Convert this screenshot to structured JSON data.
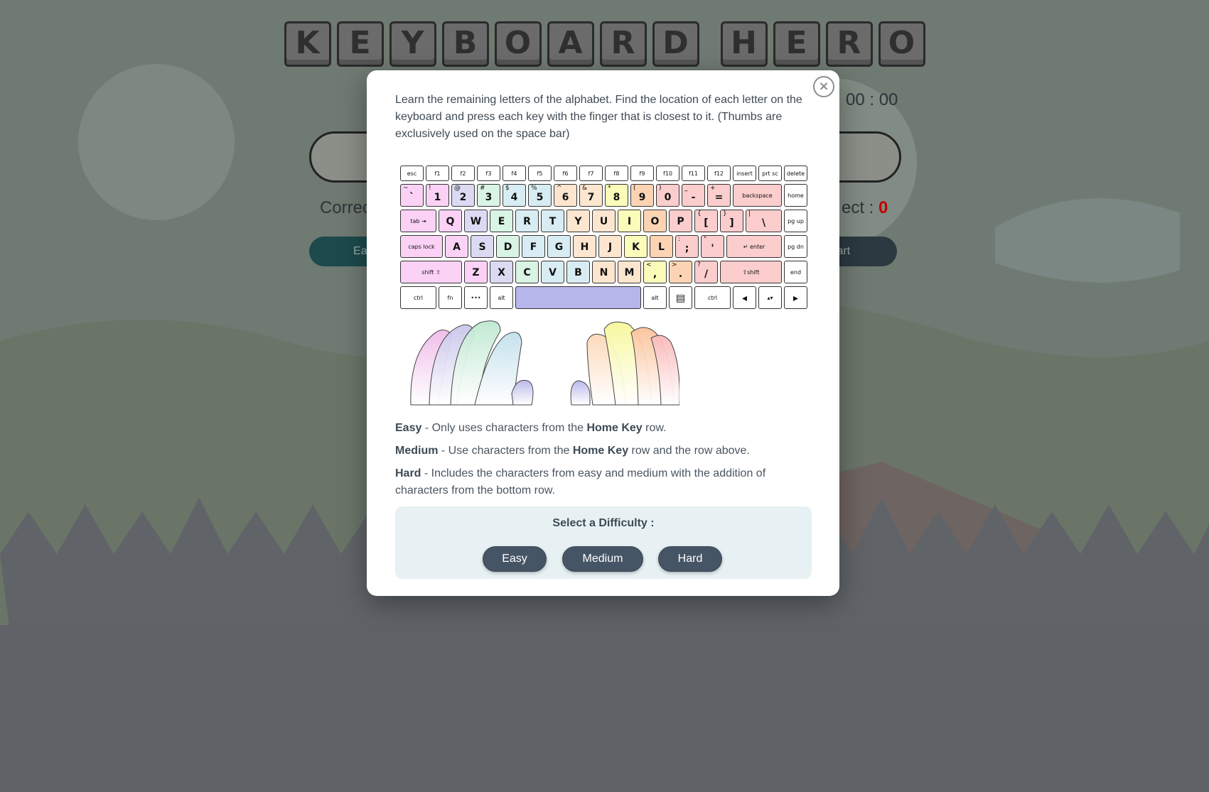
{
  "app": {
    "title_letters": [
      "K",
      "E",
      "Y",
      "B",
      "O",
      "A",
      "R",
      "D",
      " ",
      "H",
      "E",
      "R",
      "O"
    ],
    "timer": "00 : 00",
    "correct_label": "Correct :",
    "incorrect_label": "ect :",
    "incorrect_value": "0",
    "easy_partial": "Ea",
    "start_partial": "tart"
  },
  "colors": {
    "pinky_left": "#fbd2f6",
    "ring_left": "#dcdaf2",
    "middle_left": "#d9f3e4",
    "index_left": "#d8edf3",
    "index_right": "#fde6cf",
    "middle_right": "#fbfbba",
    "ring_right": "#fcd4b4",
    "pinky_right": "#fbcdcd",
    "thumb": "#b7b6ea",
    "button": "#465566",
    "incorrect": "#c40000"
  },
  "modal": {
    "close_symbol": "×",
    "intro": "Learn the remaining letters of the alphabet. Find the location of each letter on the keyboard and press each key with the finger that is closest to it. (Thumbs are exclusively used on the space bar)",
    "easy": {
      "term": "Easy",
      "pre": " - Only uses characters from the ",
      "bold": "Home Key",
      "post": " row."
    },
    "medium": {
      "term": "Medium",
      "pre": " - Use characters from the ",
      "bold": "Home Key",
      "post": " row and the row above."
    },
    "hard": {
      "term": "Hard",
      "text": " - Includes the characters from easy and medium with the addition of characters from the bottom row."
    },
    "select_label": "Select a Difficulty :",
    "buttons": {
      "easy": "Easy",
      "medium": "Medium",
      "hard": "Hard"
    }
  },
  "keyboard": {
    "rows": [
      [
        {
          "m": "esc",
          "f": "n"
        },
        {
          "m": "f1",
          "f": "n"
        },
        {
          "m": "f2",
          "f": "n"
        },
        {
          "m": "f3",
          "f": "n"
        },
        {
          "m": "f4",
          "f": "n"
        },
        {
          "m": "f5",
          "f": "n"
        },
        {
          "m": "f6",
          "f": "n"
        },
        {
          "m": "f7",
          "f": "n"
        },
        {
          "m": "f8",
          "f": "n"
        },
        {
          "m": "f9",
          "f": "n"
        },
        {
          "m": "f10",
          "f": "n"
        },
        {
          "m": "f11",
          "f": "n"
        },
        {
          "m": "f12",
          "f": "n"
        },
        {
          "m": "insert",
          "f": "n"
        },
        {
          "m": "prt sc",
          "f": "n"
        },
        {
          "m": "delete",
          "f": "n"
        }
      ],
      [
        {
          "m": "`",
          "s": "~",
          "f": "lp"
        },
        {
          "m": "1",
          "s": "!",
          "f": "lp"
        },
        {
          "m": "2",
          "s": "@",
          "f": "lr"
        },
        {
          "m": "3",
          "s": "#",
          "f": "lm"
        },
        {
          "m": "4",
          "s": "$",
          "f": "li"
        },
        {
          "m": "5",
          "s": "%",
          "f": "li"
        },
        {
          "m": "6",
          "s": "^",
          "f": "ri"
        },
        {
          "m": "7",
          "s": "&",
          "f": "ri"
        },
        {
          "m": "8",
          "s": "*",
          "f": "rm"
        },
        {
          "m": "9",
          "s": "(",
          "f": "rr"
        },
        {
          "m": "0",
          "s": ")",
          "f": "rp"
        },
        {
          "m": "-",
          "s": "_",
          "f": "rp"
        },
        {
          "m": "=",
          "s": "+",
          "f": "rp"
        },
        {
          "m": "backspace",
          "f": "rp"
        },
        {
          "m": "home",
          "f": "n"
        }
      ],
      [
        {
          "m": "tab ⇥",
          "f": "lp"
        },
        {
          "m": "Q",
          "f": "lp"
        },
        {
          "m": "W",
          "f": "lr"
        },
        {
          "m": "E",
          "f": "lm"
        },
        {
          "m": "R",
          "f": "li"
        },
        {
          "m": "T",
          "f": "li"
        },
        {
          "m": "Y",
          "f": "ri"
        },
        {
          "m": "U",
          "f": "ri"
        },
        {
          "m": "I",
          "f": "rm"
        },
        {
          "m": "O",
          "f": "rr"
        },
        {
          "m": "P",
          "f": "rp"
        },
        {
          "m": "[",
          "s": "{",
          "f": "rp"
        },
        {
          "m": "]",
          "s": "}",
          "f": "rp"
        },
        {
          "m": "\\",
          "s": "|",
          "f": "rp"
        },
        {
          "m": "pg up",
          "f": "n"
        }
      ],
      [
        {
          "m": "caps lock",
          "f": "lp"
        },
        {
          "m": "A",
          "f": "lp"
        },
        {
          "m": "S",
          "f": "lr"
        },
        {
          "m": "D",
          "f": "lm"
        },
        {
          "m": "F",
          "f": "li"
        },
        {
          "m": "G",
          "f": "li"
        },
        {
          "m": "H",
          "f": "ri"
        },
        {
          "m": "J",
          "f": "ri"
        },
        {
          "m": "K",
          "f": "rm"
        },
        {
          "m": "L",
          "f": "rr"
        },
        {
          "m": ";",
          "s": ":",
          "f": "rp"
        },
        {
          "m": "'",
          "s": "\"",
          "f": "rp"
        },
        {
          "m": "↵ enter",
          "f": "rp"
        },
        {
          "m": "pg dn",
          "f": "n"
        }
      ],
      [
        {
          "m": "shift ⇧",
          "f": "lp"
        },
        {
          "m": "Z",
          "f": "lp"
        },
        {
          "m": "X",
          "f": "lr"
        },
        {
          "m": "C",
          "f": "lm"
        },
        {
          "m": "V",
          "f": "li"
        },
        {
          "m": "B",
          "f": "li"
        },
        {
          "m": "N",
          "f": "ri"
        },
        {
          "m": "M",
          "f": "ri"
        },
        {
          "m": ",",
          "s": "<",
          "f": "rm"
        },
        {
          "m": ".",
          "s": ">",
          "f": "rr"
        },
        {
          "m": "/",
          "s": "?",
          "f": "rp"
        },
        {
          "m": "⇧shift",
          "f": "rp"
        },
        {
          "m": "end",
          "f": "n"
        }
      ],
      [
        {
          "m": "ctrl",
          "f": "n"
        },
        {
          "m": "fn",
          "f": "n"
        },
        {
          "m": "•••",
          "f": "n"
        },
        {
          "m": "alt",
          "f": "n"
        },
        {
          "m": "",
          "f": "th"
        },
        {
          "m": "alt",
          "f": "n"
        },
        {
          "m": "▤",
          "f": "n"
        },
        {
          "m": "ctrl",
          "f": "n"
        },
        {
          "m": "◂",
          "f": "n"
        },
        {
          "m": "▴▾",
          "f": "n"
        },
        {
          "m": "▸",
          "f": "n"
        }
      ]
    ]
  }
}
